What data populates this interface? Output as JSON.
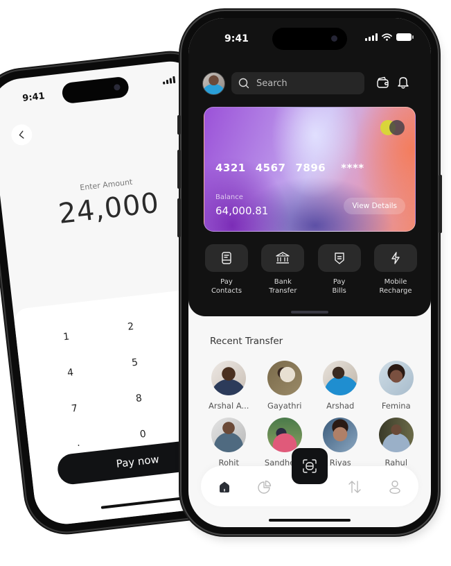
{
  "amount_screen": {
    "status": {
      "time": "9:41"
    },
    "back_icon": "chevron-left-icon",
    "enter_label": "Enter Amount",
    "amount": "24,000",
    "keypad": {
      "keys": [
        "1",
        "2",
        "4",
        "5",
        "7",
        "8",
        ".",
        "0"
      ]
    },
    "pay_button": "Pay now"
  },
  "home_screen": {
    "status": {
      "time": "9:41"
    },
    "search": {
      "placeholder": "Search"
    },
    "header_icons": [
      "wallet-icon",
      "bell-icon"
    ],
    "card": {
      "number_groups": [
        "4321",
        "4567",
        "7896",
        "****"
      ],
      "balance_label": "Balance",
      "balance": "64,000.81",
      "view_details": "View Details",
      "brand_icon": "mastercard-icon"
    },
    "actions": [
      {
        "line1": "Pay",
        "line2": "Contacts",
        "icon": "contact-book-icon"
      },
      {
        "line1": "Bank",
        "line2": "Transfer",
        "icon": "bank-icon"
      },
      {
        "line1": "Pay",
        "line2": "Bills",
        "icon": "bill-icon"
      },
      {
        "line1": "Mobile",
        "line2": "Recharge",
        "icon": "lightning-icon"
      }
    ],
    "recent_title": "Recent Transfer",
    "contacts": [
      {
        "name": "Arshal A..."
      },
      {
        "name": "Gayathri"
      },
      {
        "name": "Arshad"
      },
      {
        "name": "Femina"
      },
      {
        "name": "Rohit"
      },
      {
        "name": "Sandheep"
      },
      {
        "name": "Riyas"
      },
      {
        "name": "Rahul"
      }
    ],
    "bottom_nav": [
      {
        "name": "home",
        "icon": "home-icon",
        "active": true
      },
      {
        "name": "stats",
        "icon": "pie-chart-icon",
        "active": false
      },
      {
        "name": "scan",
        "icon": "scan-icon",
        "active": false
      },
      {
        "name": "transfer",
        "icon": "transfer-arrows-icon",
        "active": false
      },
      {
        "name": "profile",
        "icon": "user-icon",
        "active": false
      }
    ]
  }
}
